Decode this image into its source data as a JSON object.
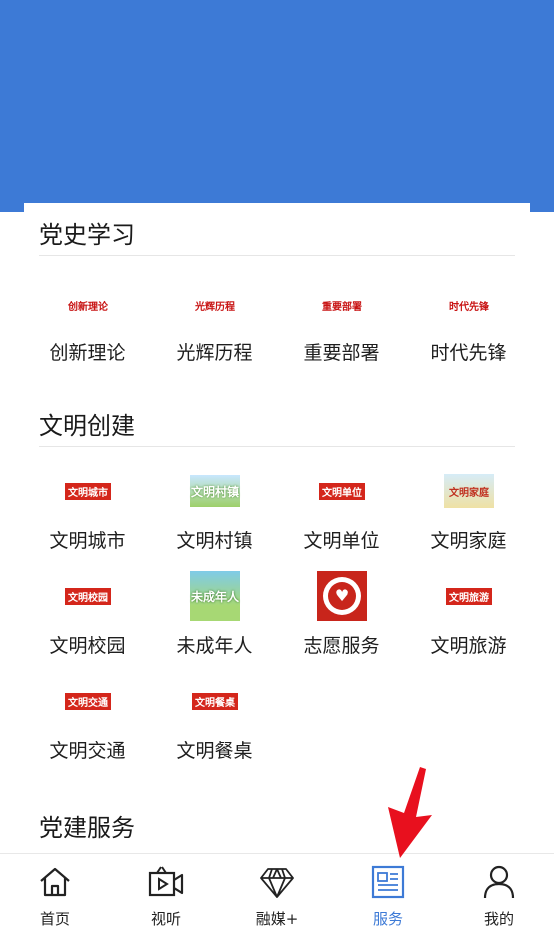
{
  "sections": [
    {
      "title": "党史学习",
      "items": [
        {
          "label": "创新理论",
          "thumb_text": "创新理论",
          "thumb_style": "red-text"
        },
        {
          "label": "光辉历程",
          "thumb_text": "光辉历程",
          "thumb_style": "red-text"
        },
        {
          "label": "重要部署",
          "thumb_text": "重要部署",
          "thumb_style": "red-text"
        },
        {
          "label": "时代先锋",
          "thumb_text": "时代先锋",
          "thumb_style": "red-text"
        }
      ]
    },
    {
      "title": "文明创建",
      "items": [
        {
          "label": "文明城市",
          "thumb_text": "文明城市",
          "thumb_style": "red-box"
        },
        {
          "label": "文明村镇",
          "thumb_text": "文明村镇",
          "thumb_style": "green-image"
        },
        {
          "label": "文明单位",
          "thumb_text": "文明单位",
          "thumb_style": "red-box"
        },
        {
          "label": "文明家庭",
          "thumb_text": "文明家庭",
          "thumb_style": "yellow-image"
        },
        {
          "label": "文明校园",
          "thumb_text": "文明校园",
          "thumb_style": "red-box"
        },
        {
          "label": "未成年人",
          "thumb_text": "未成年人",
          "thumb_style": "sky-image"
        },
        {
          "label": "志愿服务",
          "thumb_text": "",
          "thumb_style": "volunteer-logo"
        },
        {
          "label": "文明旅游",
          "thumb_text": "文明旅游",
          "thumb_style": "red-box"
        },
        {
          "label": "文明交通",
          "thumb_text": "文明交通",
          "thumb_style": "red-box"
        },
        {
          "label": "文明餐桌",
          "thumb_text": "文明餐桌",
          "thumb_style": "red-box"
        }
      ]
    },
    {
      "title": "党建服务",
      "items": []
    }
  ],
  "tabbar": [
    {
      "label": "首页",
      "icon": "home-icon",
      "active": false
    },
    {
      "label": "视听",
      "icon": "video-icon",
      "active": false
    },
    {
      "label": "融媒+",
      "icon": "diamond-icon",
      "active": false
    },
    {
      "label": "服务",
      "icon": "news-icon",
      "active": true
    },
    {
      "label": "我的",
      "icon": "user-icon",
      "active": false
    }
  ],
  "colors": {
    "hero": "#3d7ad6",
    "active_tab": "#3d7ad6",
    "annotation_arrow": "#e8101e"
  }
}
